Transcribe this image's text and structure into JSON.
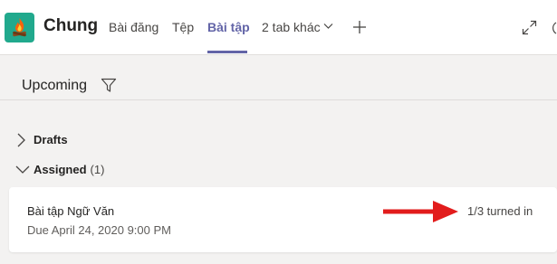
{
  "header": {
    "channel_name": "Chung",
    "logo_icon": "campfire-icon",
    "tabs": [
      {
        "label": "Bài đăng",
        "active": false
      },
      {
        "label": "Tệp",
        "active": false
      },
      {
        "label": "Bài tập",
        "active": true
      },
      {
        "label": "2 tab khác",
        "active": false
      }
    ],
    "accent_color": "#6264a7",
    "logo_color": "#21a98d"
  },
  "toolbar": {
    "view_label": "Upcoming",
    "filter_icon": "filter-icon"
  },
  "sections": [
    {
      "label": "Drafts",
      "count": "",
      "expanded": false
    },
    {
      "label": "Assigned",
      "count": "(1)",
      "expanded": true
    }
  ],
  "assignments": [
    {
      "title": "Bài tập Ngữ Văn",
      "due": "Due April 24, 2020 9:00 PM",
      "status": "1/3 turned in"
    }
  ],
  "annotation": {
    "arrow_color": "#e21c1c"
  }
}
